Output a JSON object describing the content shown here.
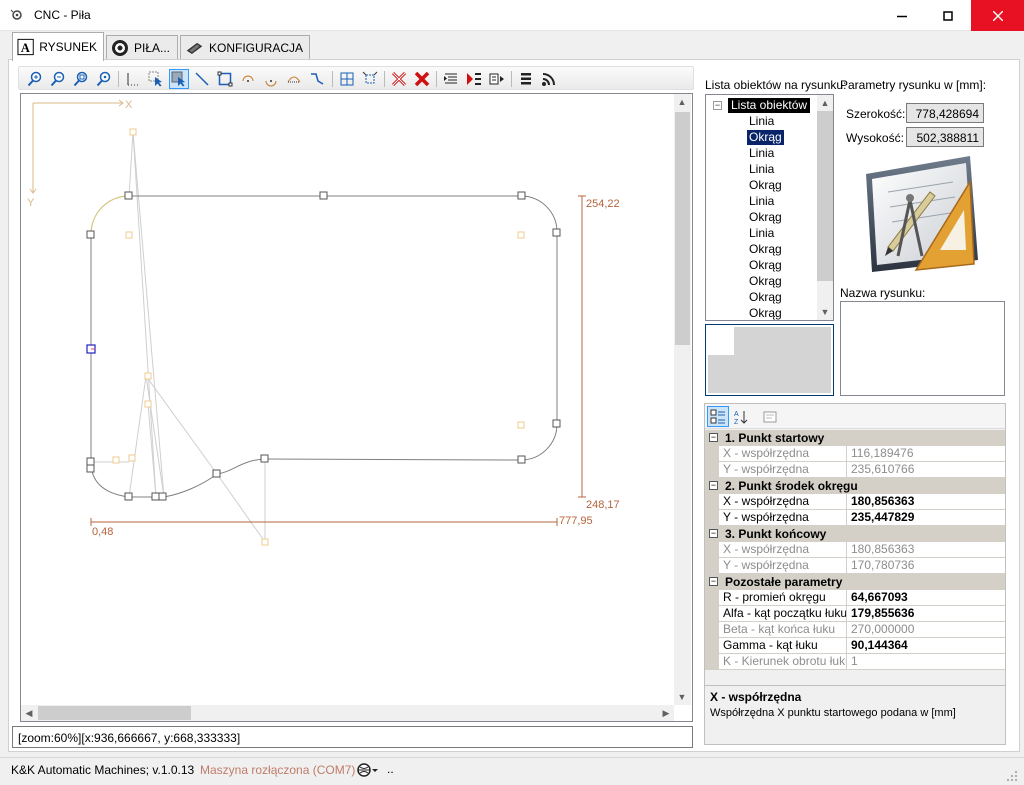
{
  "window": {
    "title": "CNC - Piła"
  },
  "tabs": [
    {
      "label": "RYSUNEK",
      "active": true
    },
    {
      "label": "PIŁA...",
      "active": false
    },
    {
      "label": "KONFIGURACJA",
      "active": false
    }
  ],
  "toolbar": {
    "buttons": [
      "zoom-in-icon",
      "zoom-out-icon",
      "zoom-fit-icon",
      "zoom-window-icon",
      "measure-icon",
      "select-icon",
      "select-window-icon",
      "line-icon",
      "rectangle-icon",
      "arc-cw-icon",
      "arc-ccw-icon",
      "arc-icon",
      "polyline-icon",
      "grid-icon",
      "snap-icon",
      "delete-selected-icon",
      "delete-all-icon",
      "list-icon",
      "cut-icon",
      "copy-icon",
      "menu-icon",
      "signal-icon"
    ]
  },
  "canvas": {
    "axis_x": "X",
    "axis_y": "Y",
    "dim_top": "254,22",
    "dim_bottom": "248,17",
    "dim_left": "0,48",
    "dim_right": "777,95"
  },
  "zoom_status": "[zoom:60%][x:936,666667, y:668,333333]",
  "object_list": {
    "label": "Lista obiektów na rysunku:",
    "root": "Lista obiektów",
    "items": [
      {
        "label": "Linia",
        "selected": false
      },
      {
        "label": "Okrąg",
        "selected": true
      },
      {
        "label": "Linia",
        "selected": false
      },
      {
        "label": "Linia",
        "selected": false
      },
      {
        "label": "Okrąg",
        "selected": false
      },
      {
        "label": "Linia",
        "selected": false
      },
      {
        "label": "Okrąg",
        "selected": false
      },
      {
        "label": "Linia",
        "selected": false
      },
      {
        "label": "Okrąg",
        "selected": false
      },
      {
        "label": "Okrąg",
        "selected": false
      },
      {
        "label": "Okrąg",
        "selected": false
      },
      {
        "label": "Okrąg",
        "selected": false
      },
      {
        "label": "Okrąg",
        "selected": false
      }
    ]
  },
  "params": {
    "label": "Parametry rysunku w [mm]:",
    "width_label": "Szerokość:",
    "width_value": "778,428694",
    "height_label": "Wysokość:",
    "height_value": "502,388811",
    "name_label": "Nazwa rysunku:",
    "name_value": ""
  },
  "property_grid": {
    "categories": [
      {
        "title": "1. Punkt startowy",
        "rows": [
          {
            "name": "X - współrzędna",
            "value": "116,189476",
            "readonly": true
          },
          {
            "name": "Y - współrzędna",
            "value": "235,610766",
            "readonly": true
          }
        ]
      },
      {
        "title": "2. Punkt środek okręgu",
        "rows": [
          {
            "name": "X - współrzędna",
            "value": "180,856363",
            "readonly": false
          },
          {
            "name": "Y - współrzędna",
            "value": "235,447829",
            "readonly": false
          }
        ]
      },
      {
        "title": "3. Punkt końcowy",
        "rows": [
          {
            "name": "X - współrzędna",
            "value": "180,856363",
            "readonly": true
          },
          {
            "name": "Y - współrzędna",
            "value": "170,780736",
            "readonly": true
          }
        ]
      },
      {
        "title": "Pozostałe parametry",
        "rows": [
          {
            "name": "R - promień okręgu",
            "value": "64,667093",
            "readonly": false
          },
          {
            "name": "Alfa - kąt początku łuku",
            "value": "179,855636",
            "readonly": false
          },
          {
            "name": "Beta - kąt końca łuku",
            "value": "270,000000",
            "readonly": true
          },
          {
            "name": "Gamma - kąt łuku",
            "value": "90,144364",
            "readonly": false
          },
          {
            "name": "K - Kierunek obrotu łuku",
            "value": "1",
            "readonly": true
          }
        ]
      }
    ],
    "description_title": "X - współrzędna",
    "description_text": "Współrzędna X punktu startowego podana w [mm]"
  },
  "statusbar": {
    "app": "K&K Automatic Machines; v.1.0.13",
    "machine": "Maszyna rozłączona (COM7)",
    "dots": ".."
  },
  "colors": {
    "accent": "#0a246a",
    "close_button": "#e81123",
    "dimension": "#b4643c",
    "shape_line": "#808080",
    "disconnected_text": "#c07c6a"
  }
}
